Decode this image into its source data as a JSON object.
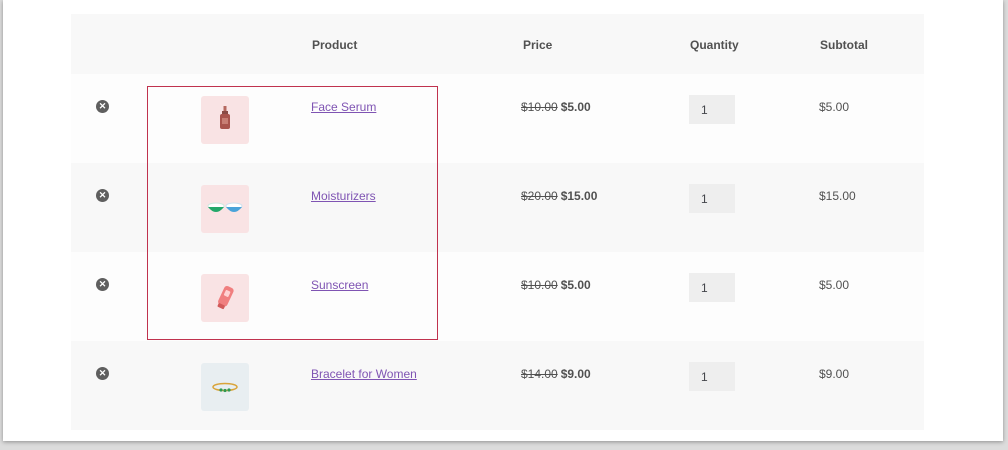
{
  "headers": {
    "product": "Product",
    "price": "Price",
    "quantity": "Quantity",
    "subtotal": "Subtotal"
  },
  "items": [
    {
      "name": "Face Serum",
      "regular_price": "$10.00",
      "sale_price": "$5.00",
      "quantity": "1",
      "subtotal": "$5.00",
      "icon": "serum-bottle-icon",
      "thumb_bg": "#f9e3e4"
    },
    {
      "name": "Moisturizers",
      "regular_price": "$20.00",
      "sale_price": "$15.00",
      "quantity": "1",
      "subtotal": "$15.00",
      "icon": "cream-jars-icon",
      "thumb_bg": "#f9e3e4"
    },
    {
      "name": "Sunscreen",
      "regular_price": "$10.00",
      "sale_price": "$5.00",
      "quantity": "1",
      "subtotal": "$5.00",
      "icon": "sunscreen-tube-icon",
      "thumb_bg": "#f9e3e4"
    },
    {
      "name": "Bracelet for Women",
      "regular_price": "$14.00",
      "sale_price": "$9.00",
      "quantity": "1",
      "subtotal": "$9.00",
      "icon": "bracelet-icon",
      "thumb_bg": "#e8eef1"
    }
  ],
  "colors": {
    "link": "#7f54b3",
    "highlight_border": "#c0324e",
    "remove_icon": "#5f5f5f"
  }
}
